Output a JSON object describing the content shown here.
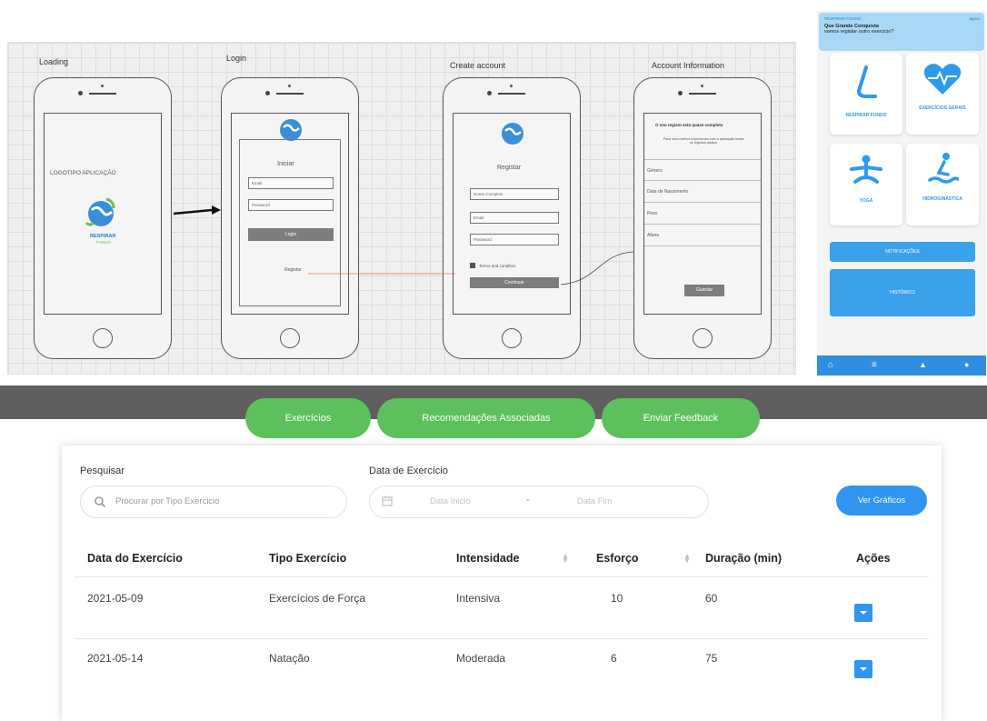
{
  "wireframe": {
    "titles": [
      "Loading",
      "Login",
      "Create account",
      "Account Information"
    ],
    "loading": {
      "logo_text": "LOGOTIPO APLICAÇÃO"
    },
    "login": {
      "title": "Iniciar",
      "email": "Email",
      "password": "Password",
      "button": "Login",
      "register_link": "Registar"
    },
    "create": {
      "title": "Registar",
      "name": "Nome Completo",
      "email": "Email",
      "password": "Password",
      "terms": "Termo and condition",
      "button": "Continuar"
    },
    "info": {
      "title": "O seu registo está quase completo",
      "subtitle": "Para uma melhor experiencia com a aplicação insira os registos abaixo",
      "rows": [
        "Género",
        "Data de Nascimento",
        "Peso",
        "Altura"
      ],
      "button": "Guardar"
    },
    "logo_brand": "RESPIRAR",
    "logo_sub": "FUNDO"
  },
  "mobile": {
    "notification": {
      "app": "RESPIRAR FUNDO",
      "time": "agora",
      "line1": "Que Grande Conquista",
      "line2": "vamos registar outro exercicio?"
    },
    "cards": [
      "RESPIRAR FUNDO",
      "EXERCÍCIOS GERAIS",
      "YOGA",
      "HIDROGINÁSTICA"
    ],
    "buttons": [
      "NOTIFICAÇÕES",
      "HISTÓRICO"
    ],
    "tab_icons": [
      "home-icon",
      "menu-icon",
      "bell-icon",
      "user-icon"
    ],
    "accent": "#3aa2ea"
  },
  "web": {
    "tabs": [
      "Exercícios",
      "Recomendações Associadas",
      "Enviar Feedback"
    ],
    "search_label": "Pesquisar",
    "search_placeholder": "Procurar por Tipo Exercicio",
    "date_label": "Data de Exercício",
    "date_start": "Data Inicio",
    "date_sep": "-",
    "date_end": "Data Fim",
    "charts_button": "Ver Gráficos",
    "columns": [
      "Data do Exercício",
      "Tipo Exercício",
      "Intensidade",
      "Esforço",
      "Duração (min)",
      "Ações"
    ],
    "rows": [
      {
        "date": "2021-05-09",
        "type": "Exercícios de Força",
        "intensity": "Intensiva",
        "effort": "10",
        "duration": "60"
      },
      {
        "date": "2021-05-14",
        "type": "Natação",
        "intensity": "Moderada",
        "effort": "6",
        "duration": "75"
      }
    ],
    "colors": {
      "green": "#5cc15c",
      "blue": "#2f95f1",
      "bar": "#5f5f5f"
    }
  }
}
